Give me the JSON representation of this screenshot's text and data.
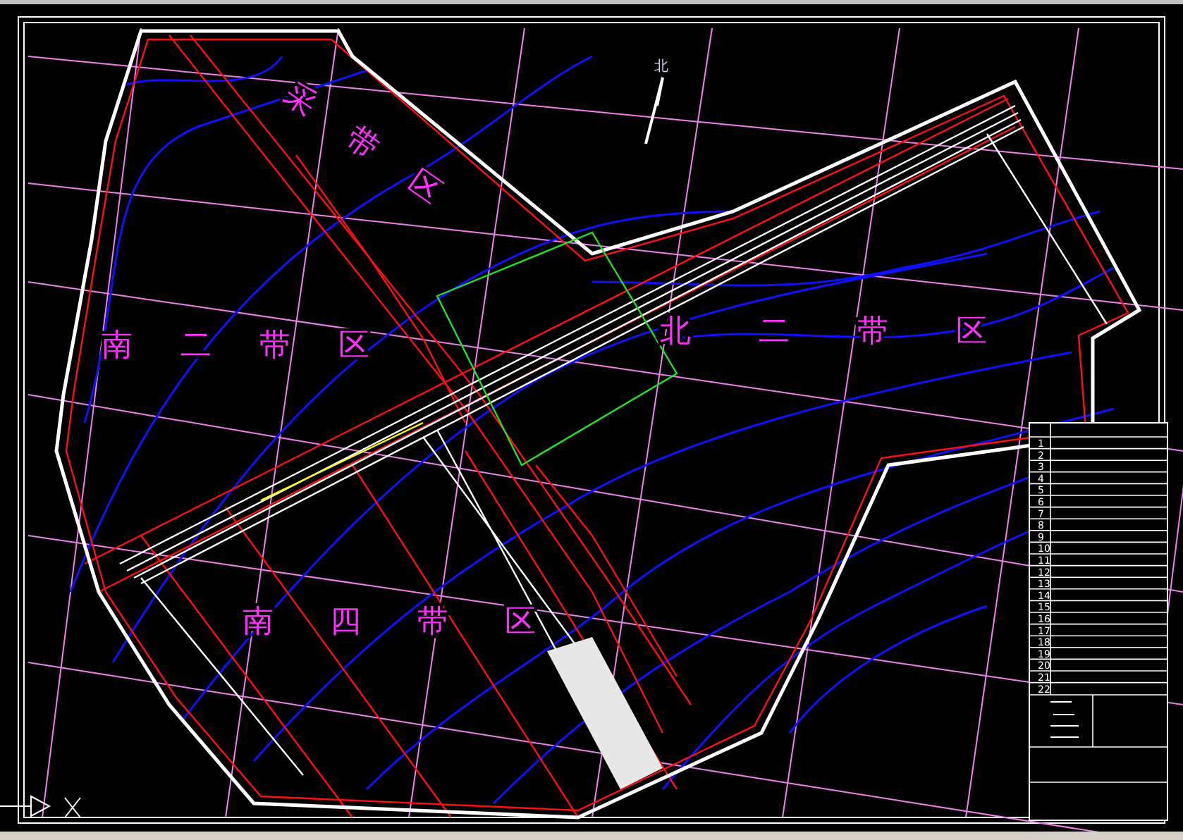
{
  "drawing": {
    "north_label": "北",
    "zone_labels": [
      {
        "text": "采带区"
      },
      {
        "text": "南二带区"
      },
      {
        "text": "北二带区"
      },
      {
        "text": "南四带区"
      }
    ],
    "legend_rows": [
      "1",
      "2",
      "3",
      "4",
      "5",
      "6",
      "7",
      "8",
      "9",
      "10",
      "11",
      "12",
      "13",
      "14",
      "15",
      "16",
      "17",
      "18",
      "19",
      "20",
      "21",
      "22"
    ]
  }
}
